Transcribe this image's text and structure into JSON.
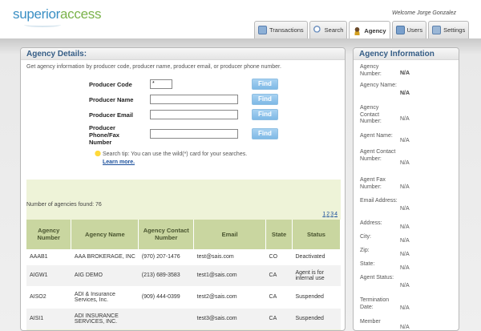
{
  "app": {
    "logo_part1": "superior",
    "logo_part2": "access",
    "welcome": "Welcome Jorge Gonzalez"
  },
  "tabs": [
    {
      "label": "Transactions",
      "icon": "transactions-icon"
    },
    {
      "label": "Search",
      "icon": "search-icon"
    },
    {
      "label": "Agency",
      "icon": "agency-icon"
    },
    {
      "label": "Users",
      "icon": "users-icon"
    },
    {
      "label": "Settings",
      "icon": "settings-icon"
    }
  ],
  "main": {
    "title": "Agency Details:",
    "subtitle": "Get agency information by producer code, producer name, producer email, or producer phone number.",
    "fields": [
      {
        "label": "Producer Code",
        "value": "*",
        "button": "Find"
      },
      {
        "label": "Producer Name",
        "value": "",
        "button": "Find"
      },
      {
        "label": "Producer Email",
        "value": "",
        "button": "Find"
      },
      {
        "label": "Producer Phone/Fax Number",
        "value": "",
        "button": "Find"
      }
    ],
    "tip_text": "Search tip: You can use the wild(*) card for your searches.",
    "tip_link": "Learn more.",
    "found_text": "Number of agencies found: 76",
    "pages": [
      "1",
      "2",
      "3",
      "4"
    ],
    "columns": [
      "Agency Number",
      "Agency Name",
      "Agency Contact Number",
      "Email",
      "State",
      "Status"
    ],
    "rows": [
      [
        "AAAB1",
        "AAA BROKERAGE, INC",
        "(970) 207-1476",
        "test@sais.com",
        "CO",
        "Deactivated"
      ],
      [
        "AIGW1",
        "AIG DEMO",
        "(213) 689-3583",
        "test1@sais.com",
        "CA",
        "Agent is for internal use"
      ],
      [
        "AISO2",
        "ADI & Insurance Services, Inc.",
        "(909) 444-0399",
        "test2@sais.com",
        "CA",
        "Suspended"
      ],
      [
        "AISI1",
        "ADI INSURANCE SERVICES, INC.",
        "",
        "test3@sais.com",
        "CA",
        "Suspended"
      ]
    ]
  },
  "side": {
    "title": "Agency Information",
    "items": [
      {
        "key": "Agency Number:",
        "value": "N/A",
        "bold": true
      },
      {
        "key": "Agency Name:",
        "value": "N/A",
        "bold": true
      },
      {
        "key": "Agency Contact Number:",
        "value": "N/A",
        "bold": false
      },
      {
        "key": "Agent Name:",
        "value": "N/A",
        "bold": false
      },
      {
        "key": "Agent Contact Number:",
        "value": "N/A",
        "bold": false
      },
      {
        "key": "Agent Fax Number:",
        "value": "N/A",
        "bold": false
      },
      {
        "key": "Email Address:",
        "value": "N/A",
        "bold": false
      },
      {
        "key": "Address:",
        "value": "N/A",
        "bold": false
      },
      {
        "key": "City:",
        "value": "N/A",
        "bold": false
      },
      {
        "key": "Zip:",
        "value": "N/A",
        "bold": false
      },
      {
        "key": "State:",
        "value": "N/A",
        "bold": false
      },
      {
        "key": "Agent Status:",
        "value": "N/A",
        "bold": false
      },
      {
        "key": "Termination Date:",
        "value": "N/A",
        "bold": false
      },
      {
        "key": "Member",
        "value": "N/A",
        "bold": false
      }
    ]
  }
}
